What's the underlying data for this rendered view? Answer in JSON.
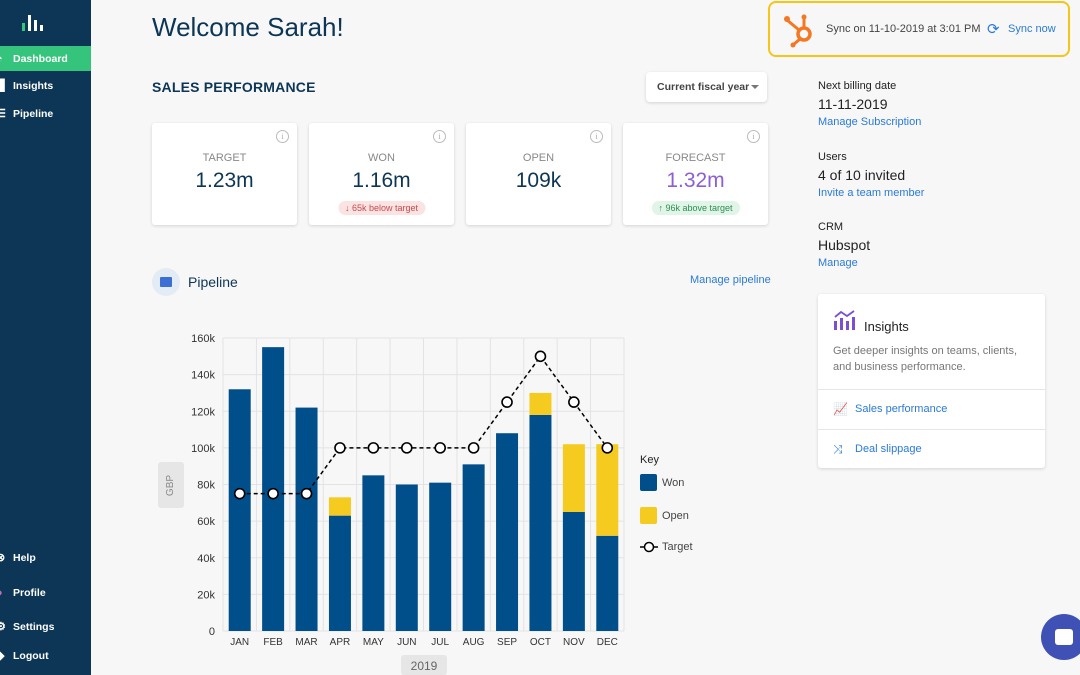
{
  "sidebar": {
    "items": [
      {
        "label": "Dashboard",
        "icon": "dashboard-icon",
        "active": true
      },
      {
        "label": "Insights",
        "icon": "insights-icon"
      },
      {
        "label": "Pipeline",
        "icon": "pipeline-icon"
      }
    ],
    "bottom_items": [
      {
        "label": "Help",
        "icon": "help-icon"
      },
      {
        "label": "Profile",
        "icon": "avatar"
      },
      {
        "label": "Settings",
        "icon": "gear-icon"
      },
      {
        "label": "Logout",
        "icon": "logout-icon"
      }
    ]
  },
  "header": {
    "welcome": "Welcome Sarah!",
    "section_title": "SALES PERFORMANCE",
    "period_select": "Current fiscal year"
  },
  "sync": {
    "text": "Sync on 11-10-2019 at 3:01 PM",
    "action": "Sync now"
  },
  "cards": [
    {
      "label": "TARGET",
      "value": "1.23m"
    },
    {
      "label": "WON",
      "value": "1.16m",
      "badge": "↓ 65k below target"
    },
    {
      "label": "OPEN",
      "value": "109k"
    },
    {
      "label": "FORECAST",
      "value": "1.32m",
      "badge": "↑ 96k above target"
    }
  ],
  "pipeline": {
    "title": "Pipeline",
    "manage_link": "Manage pipeline"
  },
  "account": {
    "billing_label": "Next billing date",
    "billing_value": "11-11-2019",
    "billing_link": "Manage Subscription",
    "users_label": "Users",
    "users_value": "4 of 10 invited",
    "users_link": "Invite a team member",
    "crm_label": "CRM",
    "crm_value": "Hubspot",
    "crm_link": "Manage"
  },
  "insights": {
    "title": "Insights",
    "description": "Get deeper insights on teams, clients, and business performance.",
    "links": [
      "Sales performance",
      "Deal slippage"
    ]
  },
  "colors": {
    "won": "#004f8b",
    "open": "#f5cb1f",
    "forecast": "#8c5fd6",
    "accent": "#35c47b",
    "link": "#2a7ad9"
  },
  "chart_data": {
    "type": "bar",
    "stacked": true,
    "categories": [
      "JAN",
      "FEB",
      "MAR",
      "APR",
      "MAY",
      "JUN",
      "JUL",
      "AUG",
      "SEP",
      "OCT",
      "NOV",
      "DEC"
    ],
    "series": [
      {
        "name": "Won",
        "values": [
          132,
          155,
          122,
          63,
          85,
          80,
          81,
          91,
          108,
          118,
          65,
          52
        ]
      },
      {
        "name": "Open",
        "values": [
          0,
          0,
          0,
          10,
          0,
          0,
          0,
          0,
          0,
          12,
          37,
          50
        ]
      },
      {
        "name": "Target",
        "type": "line",
        "values": [
          75,
          75,
          75,
          100,
          100,
          100,
          100,
          100,
          125,
          150,
          125,
          100
        ]
      }
    ],
    "yticks": [
      "0",
      "20k",
      "40k",
      "60k",
      "80k",
      "100k",
      "120k",
      "140k",
      "160k"
    ],
    "ylim": [
      0,
      160
    ],
    "unit": "k",
    "ylabel": "GBP",
    "xlabel": "2019",
    "legend_title": "Key",
    "legend": [
      "Won",
      "Open",
      "Target"
    ],
    "legend_position": "right",
    "grid": true
  }
}
